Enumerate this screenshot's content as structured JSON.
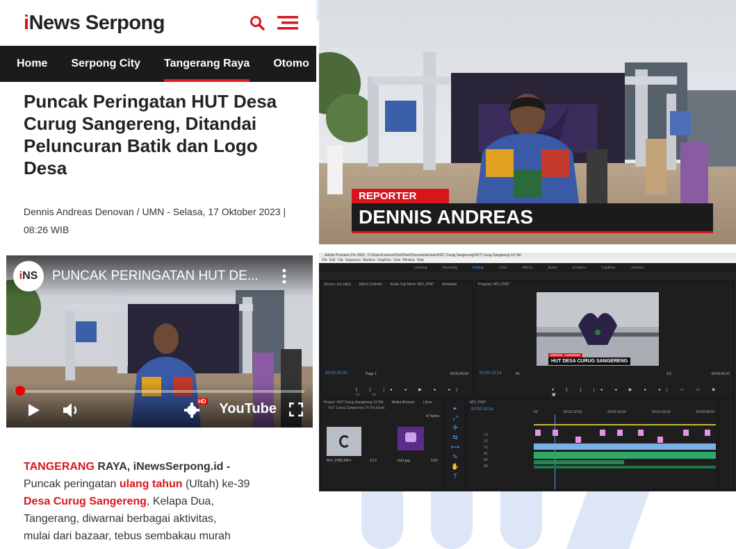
{
  "article_header": {
    "logo_i": "i",
    "logo_rest": "News Serpong",
    "nav": [
      "Home",
      "Serpong City",
      "Tangerang Raya",
      "Otomo"
    ],
    "active_nav_index": 2,
    "headline": "Puncak Peringatan HUT Desa Curug Sangereng, Ditandai Peluncuran Batik dan Logo Desa",
    "byline_line1": "Dennis Andreas Denovan / UMN - Selasa, 17 Oktober 2023 |",
    "byline_line2": "08:26 WIB"
  },
  "video_frame": {
    "tag": "REPORTER",
    "name": "DENNIS ANDREAS"
  },
  "youtube": {
    "channel_i": "i",
    "channel_rest": "NS",
    "title": "PUNCAK PERINGATAN HUT DE...",
    "progress": 0.02,
    "brand": "YouTube",
    "hd": "HD"
  },
  "article_body": {
    "kw_location": "TANGERANG",
    "location_rest": " RAYA, iNewsSerpong.id -",
    "t1": "Puncak peringatan ",
    "kw1": "ulang tahun",
    "t2": " (Ultah) ke-39",
    "kw2": "Desa Curug Sangereng",
    "t3": ", Kelapa Dua,",
    "t4": "Tangerang, diwarnai berbagai aktivitas,",
    "t5": "mulai dari bazaar, tebus sembakau murah"
  },
  "premiere": {
    "title": "Adobe Premiere Pro 2022 - C:\\Users\\Lenovo\\OneDrive\\Documents\\news\\HUT Curug Sangereng\\HUT Curug Sangereng 14 Okt",
    "menu": [
      "File",
      "Edit",
      "Clip",
      "Sequence",
      "Markers",
      "Graphics",
      "View",
      "Window",
      "Help"
    ],
    "workspaces": [
      "Learning",
      "Assembly",
      "Editing",
      "Color",
      "Effects",
      "Audio",
      "Graphics",
      "Captions",
      "Libraries"
    ],
    "active_workspace": "Editing",
    "source_tabs": [
      "Source: (no clips)",
      "Effect Controls",
      "Audio Clip Mixer: MVI_P087",
      "Metadata"
    ],
    "program_tab": "Program: MVI_P087",
    "source_tc_left": "00;00;00;00",
    "source_page": "Page 1",
    "source_tc_right": "00;00;00;00",
    "program_tc": "00:00:19:14",
    "program_fit": "Fit",
    "program_tc_right": "00:03:05:10",
    "program_ratio": "1/2",
    "program_lt_tag": "SERPONG - TANGERANG",
    "program_lt_text": "HUT DESA CURUG SANGERENG",
    "project_tabs": [
      "Project: HUT Curug Sangereng 14 Okt",
      "Media Browser",
      "Librar"
    ],
    "project_file": "HUT Curug Sangereng 14 Okt.prproj",
    "item_count": "47 Items",
    "bins": [
      {
        "name": "MVI_P080.MP4",
        "dur": "3:13"
      },
      {
        "name": "hut1.jpg",
        "dur": "5:00"
      }
    ],
    "timeline_tab": "MVI_P087",
    "timeline_tc": "00:00:19:14",
    "ruler": [
      "00",
      "00:01:12:00",
      "00:01:04:00",
      "00:01:56:00",
      "00:02:08:00"
    ],
    "tracks_v": [
      "V3",
      "V2",
      "V1"
    ],
    "tracks_a": [
      "A1",
      "A2",
      "A3"
    ]
  }
}
